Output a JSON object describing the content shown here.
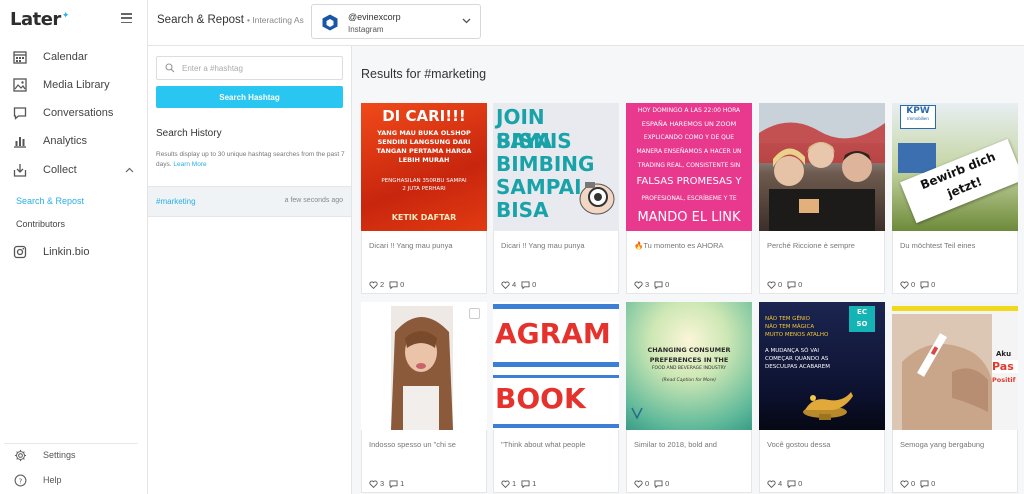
{
  "app": {
    "logo_text": "Later",
    "colors": {
      "accent": "#29c6f1",
      "link": "#29aee6",
      "brand_hex": "#1a56a8"
    }
  },
  "sidebar": {
    "items": [
      {
        "label": "Calendar",
        "icon": "calendar-icon"
      },
      {
        "label": "Media Library",
        "icon": "image-icon"
      },
      {
        "label": "Conversations",
        "icon": "chat-icon"
      },
      {
        "label": "Analytics",
        "icon": "bar-chart-icon"
      },
      {
        "label": "Collect",
        "icon": "inbox-download-icon"
      }
    ],
    "collect_sub": [
      {
        "label": "Search & Repost",
        "active": true
      },
      {
        "label": "Contributors",
        "active": false
      }
    ],
    "linkin": {
      "label": "Linkin.bio",
      "icon": "instagram-icon"
    },
    "bottom": [
      {
        "label": "Settings",
        "icon": "gear-icon"
      },
      {
        "label": "Help",
        "icon": "help-circle-icon"
      }
    ]
  },
  "header": {
    "title": "Search & Repost",
    "subtitle": "• Interacting As",
    "account": {
      "handle": "@evinexcorp",
      "platform": "Instagram"
    }
  },
  "search": {
    "placeholder": "Enter a #hashtag",
    "button_label": "Search Hashtag",
    "history_title": "Search History",
    "history_desc": "Results display up to 30 unique hashtag searches from the past 7 days.",
    "learn_more": "Learn More",
    "history": [
      {
        "tag": "#marketing",
        "time": "a few seconds ago"
      }
    ]
  },
  "results": {
    "title": "Results for #marketing",
    "posts": [
      {
        "caption": "Dicari !! Yang mau punya",
        "likes": "2",
        "comments": "0",
        "thumb_text": [
          "DI CARI!!!",
          "YANG MAU BUKA OLSHOP",
          "SENDIRI LANGSUNG DARI",
          "TANGAN PERTAMA HARGA",
          "LEBIH MURAH",
          "PENGHASILAN 350RBU SAMPAI",
          "2 JUTA PERHARI",
          "KETIK DAFTAR"
        ]
      },
      {
        "caption": "Dicari !! Yang mau punya",
        "likes": "4",
        "comments": "0",
        "thumb_text": [
          "JOIN BISNIS",
          "SAYA",
          "BIMBING",
          "SAMPAI",
          "BISA"
        ]
      },
      {
        "caption": "🔥Tu momento es AHORA",
        "likes": "3",
        "comments": "0",
        "thumb_text": [
          "HOY DOMINGO A LAS 22:00 HORA",
          "ESPAÑA HAREMOS UN ZOOM",
          "EXPLICANDO COMO Y DE QUE",
          "MANERA ENSEÑAMOS A HACER UN",
          "TRADING REAL, CONSISTENTE SIN",
          "FALSAS PROMESAS Y",
          "PROFESIONAL, ESCRÍBEME Y TE",
          "MANDO EL LINK"
        ]
      },
      {
        "caption": "Perché Riccione è sempre",
        "likes": "0",
        "comments": "0",
        "thumb_text": []
      },
      {
        "caption": "Du möchtest Teil eines",
        "likes": "0",
        "comments": "0",
        "thumb_text": [
          "KPW",
          "Immobilien",
          "Bewirb dich",
          "jetzt!"
        ]
      },
      {
        "caption": "Indosso spesso un \"chi se",
        "likes": "3",
        "comments": "1",
        "thumb_text": []
      },
      {
        "caption": "\"Think about what people",
        "likes": "1",
        "comments": "1",
        "thumb_text": [
          "AGRAM",
          "BOOK"
        ]
      },
      {
        "caption": "Similar to 2018, bold and",
        "likes": "0",
        "comments": "0",
        "thumb_text": [
          "CHANGING CONSUMER",
          "PREFERENCES IN THE",
          "FOOD AND BEVERAGE INDUSTRY",
          "(Read Caption for More)"
        ]
      },
      {
        "caption": "Você gostou dessa",
        "likes": "4",
        "comments": "0",
        "thumb_text": [
          "EC",
          "SO",
          "NÃO TEM GÊNIO",
          "NÃO TEM MÁGICA",
          "MUITO MENOS ATALHO",
          "A MUDANÇA SÓ VAI",
          "COMEÇAR QUANDO AS",
          "DESCULPAS ACABAREM"
        ]
      },
      {
        "caption": "Semoga yang bergabung",
        "likes": "0",
        "comments": "0",
        "thumb_text": [
          "Aku",
          "Pas",
          "Positif H"
        ]
      }
    ]
  }
}
